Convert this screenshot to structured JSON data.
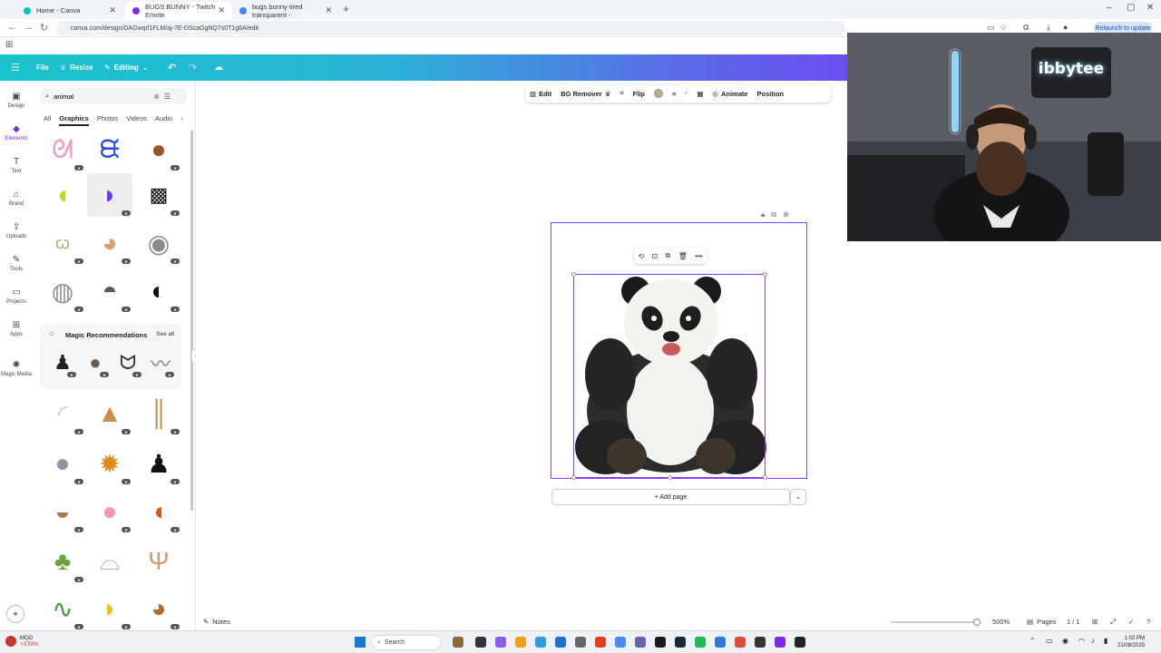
{
  "browser": {
    "tabs": [
      {
        "title": "Home - Canva",
        "active": false,
        "color": "#00c4cc"
      },
      {
        "title": "BUGS BUNNY - Twitch Emote",
        "active": true,
        "color": "#7d2ae8"
      },
      {
        "title": "bugs bunny tired transparent -",
        "active": false,
        "color": "#4285f4"
      }
    ],
    "url": "canva.com/design/DAGwqrl1FLM/aj-7E-DScaGgNQ7s0T1g8A/edit",
    "relaunch_label": "Relaunch to update"
  },
  "canva_header": {
    "file": "File",
    "resize": "Resize",
    "editing": "Editing"
  },
  "rail": [
    {
      "label": "Design",
      "icon": "layout-icon"
    },
    {
      "label": "Elements",
      "icon": "shapes-icon",
      "active": true
    },
    {
      "label": "Text",
      "icon": "text-icon"
    },
    {
      "label": "Brand",
      "icon": "brand-icon"
    },
    {
      "label": "Uploads",
      "icon": "upload-icon"
    },
    {
      "label": "Tools",
      "icon": "pen-icon"
    },
    {
      "label": "Projects",
      "icon": "folder-icon"
    },
    {
      "label": "Apps",
      "icon": "apps-icon"
    },
    {
      "label": "Magic Media",
      "icon": "magic-icon"
    }
  ],
  "panel": {
    "search_value": "animal",
    "subtabs": [
      "All",
      "Graphics",
      "Photos",
      "Videos",
      "Audio"
    ],
    "active_subtab": "Graphics",
    "magic_title": "Magic Recommendations",
    "see_all": "See all"
  },
  "context_toolbar": {
    "edit": "Edit",
    "bg_remover": "BG Remover",
    "flip": "Flip",
    "animate": "Animate",
    "position": "Position",
    "color": "#b9ad86"
  },
  "canvas": {
    "add_page": "+ Add page"
  },
  "bottom": {
    "notes": "Notes",
    "zoom": "500%",
    "pages_label": "Pages",
    "page_count": "1 / 1"
  },
  "webcam": {
    "neon_sign": "ibbytee"
  },
  "taskbar": {
    "search": "Search",
    "weather_title": "MQG",
    "weather_change": "+3.50%",
    "time": "1:02 PM",
    "date": "21/08/2025"
  }
}
